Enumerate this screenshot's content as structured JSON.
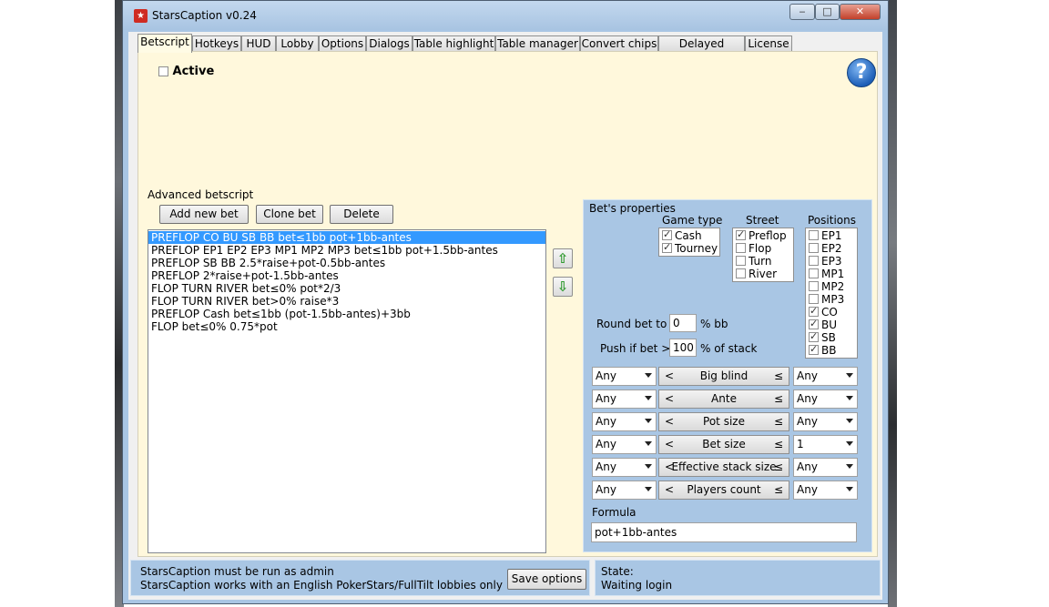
{
  "window": {
    "title": "StarsCaption v0.24",
    "app_icon": "stars-caption-app-icon",
    "min_label": "‒",
    "max_label": "□",
    "close_label": "✕"
  },
  "tabs": [
    "Betscript",
    "Hotkeys",
    "HUD",
    "Lobby",
    "Options",
    "Dialogs",
    "Table highlight",
    "Table manager",
    "Convert chips",
    "Delayed actions",
    "License"
  ],
  "active_tab": "Betscript",
  "betscript": {
    "active_label": "Active",
    "active_checked": false,
    "help_label": "?",
    "advanced_label": "Advanced betscript",
    "buttons": {
      "add": "Add new bet",
      "clone": "Clone bet",
      "delete": "Delete"
    },
    "bets": [
      "PREFLOP CO BU SB BB bet≤1bb pot+1bb-antes",
      "PREFLOP EP1 EP2 EP3 MP1 MP2 MP3 bet≤1bb pot+1.5bb-antes",
      "PREFLOP SB BB 2.5*raise+pot-0.5bb-antes",
      "PREFLOP 2*raise+pot-1.5bb-antes",
      "FLOP TURN RIVER bet≤0% pot*2/3",
      "FLOP TURN RIVER bet>0% raise*3",
      "PREFLOP Cash bet≤1bb (pot-1.5bb-antes)+3bb",
      "FLOP bet≤0% 0.75*pot"
    ],
    "selected_bet_index": 0,
    "move_up_label": "⇧",
    "move_down_label": "⇩"
  },
  "props": {
    "label": "Bet's properties",
    "game_type": {
      "label": "Game type",
      "items": [
        {
          "label": "Cash",
          "checked": true
        },
        {
          "label": "Tourney",
          "checked": true
        }
      ]
    },
    "street": {
      "label": "Street",
      "items": [
        {
          "label": "Preflop",
          "checked": true
        },
        {
          "label": "Flop",
          "checked": false
        },
        {
          "label": "Turn",
          "checked": false
        },
        {
          "label": "River",
          "checked": false
        }
      ]
    },
    "positions": {
      "label": "Positions",
      "items": [
        {
          "label": "EP1",
          "checked": false
        },
        {
          "label": "EP2",
          "checked": false
        },
        {
          "label": "EP3",
          "checked": false
        },
        {
          "label": "MP1",
          "checked": false
        },
        {
          "label": "MP2",
          "checked": false
        },
        {
          "label": "MP3",
          "checked": false
        },
        {
          "label": "CO",
          "checked": true
        },
        {
          "label": "BU",
          "checked": true
        },
        {
          "label": "SB",
          "checked": true
        },
        {
          "label": "BB",
          "checked": true
        }
      ]
    },
    "round_bet": {
      "label": "Round bet to",
      "value": "0",
      "unit": "% bb"
    },
    "push_if": {
      "label": "Push if bet >",
      "value": "100",
      "unit": "% of stack"
    },
    "conditions": [
      {
        "left": "Any",
        "lt": "<",
        "name": "Big blind",
        "le": "≤",
        "right": "Any"
      },
      {
        "left": "Any",
        "lt": "<",
        "name": "Ante",
        "le": "≤",
        "right": "Any"
      },
      {
        "left": "Any",
        "lt": "<",
        "name": "Pot size",
        "le": "≤",
        "right": "Any"
      },
      {
        "left": "Any",
        "lt": "<",
        "name": "Bet size",
        "le": "≤",
        "right": "1"
      },
      {
        "left": "Any",
        "lt": "<",
        "name": "Effective stack size",
        "le": "≤",
        "right": "Any"
      },
      {
        "left": "Any",
        "lt": "<",
        "name": "Players count",
        "le": "≤",
        "right": "Any"
      }
    ],
    "formula_label": "Formula",
    "formula_value": "pot+1bb-antes"
  },
  "status": {
    "line1": "StarsCaption must be run as admin",
    "line2": "StarsCaption works with an English PokerStars/FullTilt lobbies only",
    "save_label": "Save options",
    "state_label": "State:",
    "state_value": "Waiting login"
  }
}
